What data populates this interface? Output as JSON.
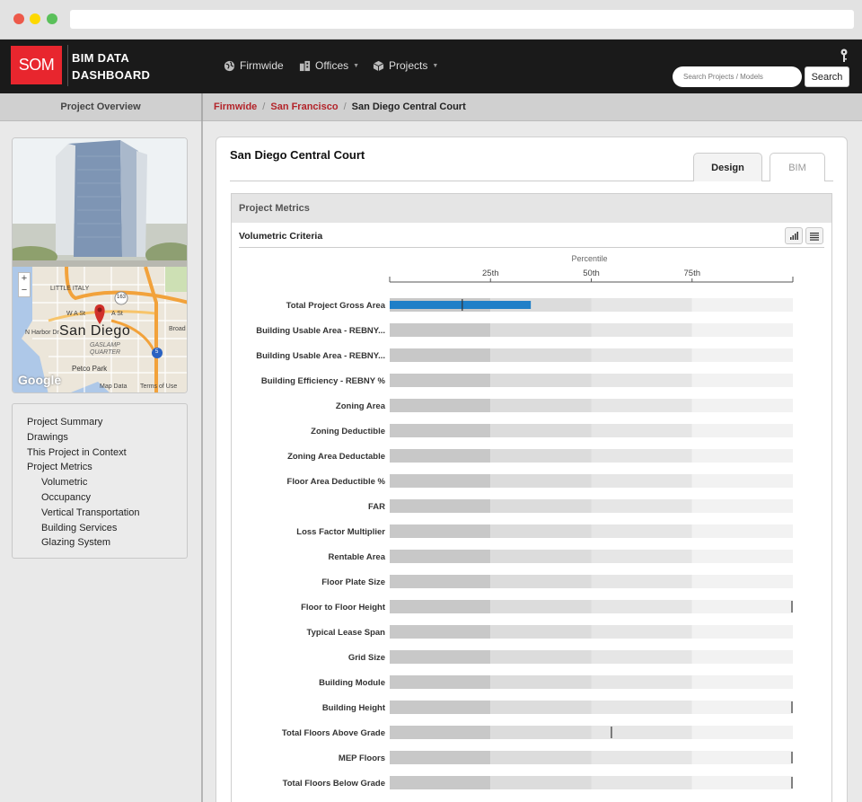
{
  "app": {
    "logo": "SOM",
    "brand_line1": "BIM DATA",
    "brand_line2": "DASHBOARD"
  },
  "nav": {
    "firmwide": "Firmwide",
    "offices": "Offices",
    "projects": "Projects",
    "search_placeholder": "Search Projects / Models",
    "search_button": "Search"
  },
  "subheader": {
    "left_title": "Project Overview",
    "breadcrumbs": [
      "Firmwide",
      "San Francisco",
      "San Diego Central Court"
    ]
  },
  "map": {
    "city_label": "San Diego",
    "labels": [
      "LITTLE ITALY",
      "W A St",
      "A St",
      "N Harbor Dr",
      "GASLAMP QUARTER",
      "Petco Park",
      "Broad",
      "163",
      "5"
    ],
    "attribution": [
      "Google",
      "Map Data",
      "Terms of Use"
    ]
  },
  "sidebar": {
    "items": [
      {
        "label": "Project Summary",
        "level": 1
      },
      {
        "label": "Drawings",
        "level": 1
      },
      {
        "label": "This Project in Context",
        "level": 1
      },
      {
        "label": "Project Metrics",
        "level": 1
      },
      {
        "label": "Volumetric",
        "level": 2
      },
      {
        "label": "Occupancy",
        "level": 2
      },
      {
        "label": "Vertical Transportation",
        "level": 2
      },
      {
        "label": "Building Services",
        "level": 2
      },
      {
        "label": "Glazing System",
        "level": 2
      }
    ]
  },
  "main": {
    "project_title": "San Diego Central Court",
    "tabs": [
      "Design",
      "BIM"
    ],
    "active_tab": "Design",
    "metrics_header": "Project Metrics",
    "section_title": "Volumetric Criteria"
  },
  "colors": {
    "accent_red": "#b3242a",
    "logo_red": "#e8262e",
    "bar_blue": "#1f7fc8"
  },
  "chart_data": {
    "type": "bar",
    "axis_title": "Percentile",
    "ticks": [
      "25th",
      "50th",
      "75th"
    ],
    "tick_values": [
      25,
      50,
      75
    ],
    "xlim": [
      0,
      100
    ],
    "band_colors": [
      "#c8c8c8",
      "#dcdcdc",
      "#e6e6e6",
      "#f2f2f2"
    ],
    "rows": [
      {
        "label": "Total Project Gross Area",
        "value": 35,
        "marker": 18
      },
      {
        "label": "Building Usable Area - REBNY...",
        "value": null,
        "marker": null
      },
      {
        "label": "Building Usable Area - REBNY...",
        "value": null,
        "marker": null
      },
      {
        "label": "Building Efficiency - REBNY %",
        "value": null,
        "marker": null
      },
      {
        "label": "Zoning Area",
        "value": null,
        "marker": null
      },
      {
        "label": "Zoning Deductible",
        "value": null,
        "marker": null
      },
      {
        "label": "Zoning Area Deductable",
        "value": null,
        "marker": null
      },
      {
        "label": "Floor Area Deductible %",
        "value": null,
        "marker": null
      },
      {
        "label": "FAR",
        "value": null,
        "marker": null
      },
      {
        "label": "Loss Factor Multiplier",
        "value": null,
        "marker": null
      },
      {
        "label": "Rentable Area",
        "value": null,
        "marker": null
      },
      {
        "label": "Floor Plate Size",
        "value": null,
        "marker": null
      },
      {
        "label": "Floor to Floor Height",
        "value": null,
        "marker": 100
      },
      {
        "label": "Typical Lease Span",
        "value": null,
        "marker": null
      },
      {
        "label": "Grid Size",
        "value": null,
        "marker": null
      },
      {
        "label": "Building Module",
        "value": null,
        "marker": null
      },
      {
        "label": "Building Height",
        "value": null,
        "marker": 100
      },
      {
        "label": "Total Floors Above Grade",
        "value": null,
        "marker": 55
      },
      {
        "label": "MEP Floors",
        "value": null,
        "marker": 100
      },
      {
        "label": "Total Floors Below Grade",
        "value": null,
        "marker": 100
      }
    ]
  }
}
